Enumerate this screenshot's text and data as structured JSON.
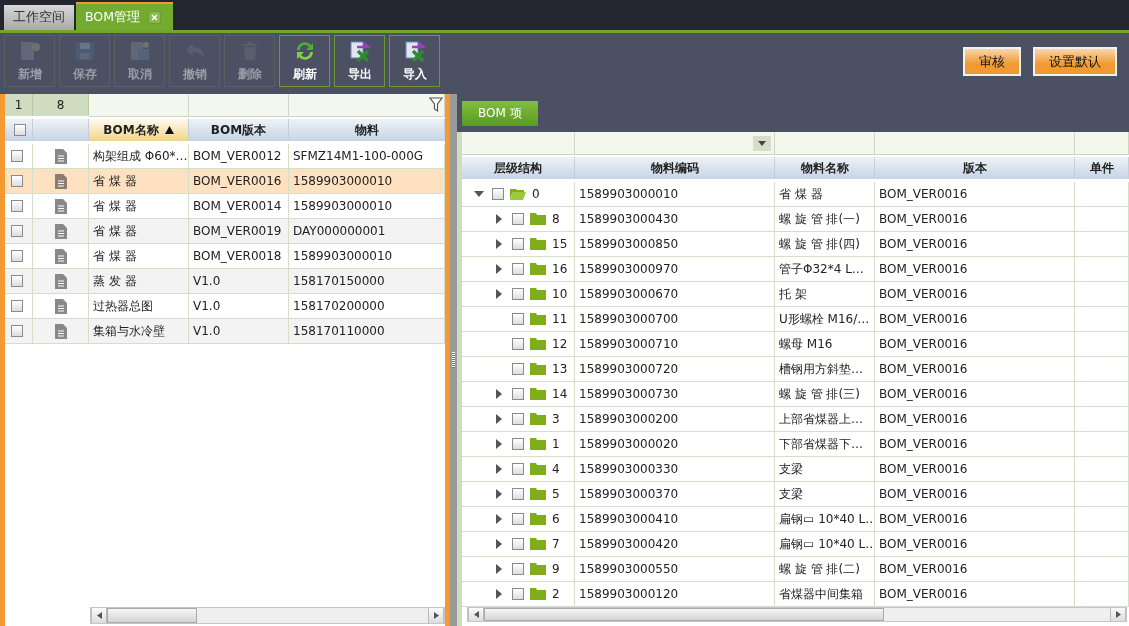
{
  "tabs": [
    {
      "label": "工作空间",
      "selected": false,
      "closable": false
    },
    {
      "label": "BOM管理",
      "selected": true,
      "closable": true
    }
  ],
  "toolbar": [
    {
      "label": "新增",
      "kind": "add",
      "disabled": true
    },
    {
      "label": "保存",
      "kind": "save",
      "disabled": true
    },
    {
      "label": "取消",
      "kind": "cancel",
      "disabled": true
    },
    {
      "label": "撤销",
      "kind": "undo",
      "disabled": true
    },
    {
      "label": "删除",
      "kind": "delete",
      "disabled": true
    },
    {
      "label": "刷新",
      "kind": "refresh",
      "disabled": false
    },
    {
      "label": "导出",
      "kind": "export",
      "disabled": false
    },
    {
      "label": "导入",
      "kind": "import",
      "disabled": false
    }
  ],
  "actions": [
    "审核",
    "设置默认"
  ],
  "bom_list": {
    "pager": [
      "1",
      "8"
    ],
    "all_checked": false,
    "columns": [
      {
        "label": "BOM名称",
        "sorted": true
      },
      {
        "label": "BOM版本",
        "sorted": false
      },
      {
        "label": "物料",
        "sorted": false
      }
    ],
    "rows": [
      {
        "name": "构架组成 Φ60*…",
        "version": "BOM_VER0012",
        "material": "SFMZ14M1-100-000G",
        "selected": false,
        "checked": false
      },
      {
        "name": "省 煤 器",
        "version": "BOM_VER0016",
        "material": "1589903000010",
        "selected": true,
        "checked": false
      },
      {
        "name": "省 煤 器",
        "version": "BOM_VER0014",
        "material": "1589903000010",
        "selected": false,
        "checked": false
      },
      {
        "name": "省 煤 器",
        "version": "BOM_VER0019",
        "material": "DAY000000001",
        "selected": false,
        "checked": false
      },
      {
        "name": "省 煤 器",
        "version": "BOM_VER0018",
        "material": "1589903000010",
        "selected": false,
        "checked": false
      },
      {
        "name": "蒸 发 器",
        "version": "V1.0",
        "material": "158170150000",
        "selected": false,
        "checked": false
      },
      {
        "name": "过热器总图",
        "version": "V1.0",
        "material": "158170200000",
        "selected": false,
        "checked": false
      },
      {
        "name": "集箱与水冷壁",
        "version": "V1.0",
        "material": "158170110000",
        "selected": false,
        "checked": false
      }
    ]
  },
  "bom_items": {
    "tab": {
      "label": "BOM 项",
      "selected": true
    },
    "columns": [
      "层级结构",
      "物料编码",
      "物料名称",
      "版本",
      "单件"
    ],
    "tree": [
      {
        "level": "0",
        "code": "1589903000010",
        "name": "省 煤 器",
        "version": "BOM_VER0016",
        "checked": false,
        "expandable": true,
        "expanded": true,
        "children": [
          {
            "level": "8",
            "code": "1589903000430",
            "name": "螺 旋 管 排(一)",
            "version": "BOM_VER0016",
            "checked": false,
            "expandable": true,
            "expanded": false
          },
          {
            "level": "15",
            "code": "1589903000850",
            "name": "螺 旋 管 排(四)",
            "version": "BOM_VER0016",
            "checked": false,
            "expandable": true,
            "expanded": false
          },
          {
            "level": "16",
            "code": "1589903000970",
            "name": "管子Φ32*4 L…",
            "version": "BOM_VER0016",
            "checked": false,
            "expandable": true,
            "expanded": false
          },
          {
            "level": "10",
            "code": "1589903000670",
            "name": "托 架",
            "version": "BOM_VER0016",
            "checked": false,
            "expandable": true,
            "expanded": false
          },
          {
            "level": "11",
            "code": "1589903000700",
            "name": "U形螺栓 M16/…",
            "version": "BOM_VER0016",
            "checked": false,
            "expandable": false,
            "expanded": false
          },
          {
            "level": "12",
            "code": "1589903000710",
            "name": "螺母 M16",
            "version": "BOM_VER0016",
            "checked": false,
            "expandable": false,
            "expanded": false
          },
          {
            "level": "13",
            "code": "1589903000720",
            "name": "槽钢用方斜垫…",
            "version": "BOM_VER0016",
            "checked": false,
            "expandable": false,
            "expanded": false
          },
          {
            "level": "14",
            "code": "1589903000730",
            "name": "螺 旋 管 排(三)",
            "version": "BOM_VER0016",
            "checked": false,
            "expandable": true,
            "expanded": false
          },
          {
            "level": "3",
            "code": "1589903000200",
            "name": "上部省煤器上…",
            "version": "BOM_VER0016",
            "checked": false,
            "expandable": true,
            "expanded": false
          },
          {
            "level": "1",
            "code": "1589903000020",
            "name": "下部省煤器下…",
            "version": "BOM_VER0016",
            "checked": false,
            "expandable": true,
            "expanded": false
          },
          {
            "level": "4",
            "code": "1589903000330",
            "name": "支梁",
            "version": "BOM_VER0016",
            "checked": false,
            "expandable": true,
            "expanded": false
          },
          {
            "level": "5",
            "code": "1589903000370",
            "name": "支梁",
            "version": "BOM_VER0016",
            "checked": false,
            "expandable": true,
            "expanded": false
          },
          {
            "level": "6",
            "code": "1589903000410",
            "name": "扁钢▭ 10*40 L…",
            "version": "BOM_VER0016",
            "checked": false,
            "expandable": true,
            "expanded": false
          },
          {
            "level": "7",
            "code": "1589903000420",
            "name": "扁钢▭ 10*40 L…",
            "version": "BOM_VER0016",
            "checked": false,
            "expandable": true,
            "expanded": false
          },
          {
            "level": "9",
            "code": "1589903000550",
            "name": "螺 旋 管 排(二)",
            "version": "BOM_VER0016",
            "checked": false,
            "expandable": true,
            "expanded": false
          },
          {
            "level": "2",
            "code": "1589903000120",
            "name": "省煤器中间集箱",
            "version": "BOM_VER0016",
            "checked": false,
            "expandable": true,
            "expanded": false
          }
        ]
      }
    ]
  }
}
